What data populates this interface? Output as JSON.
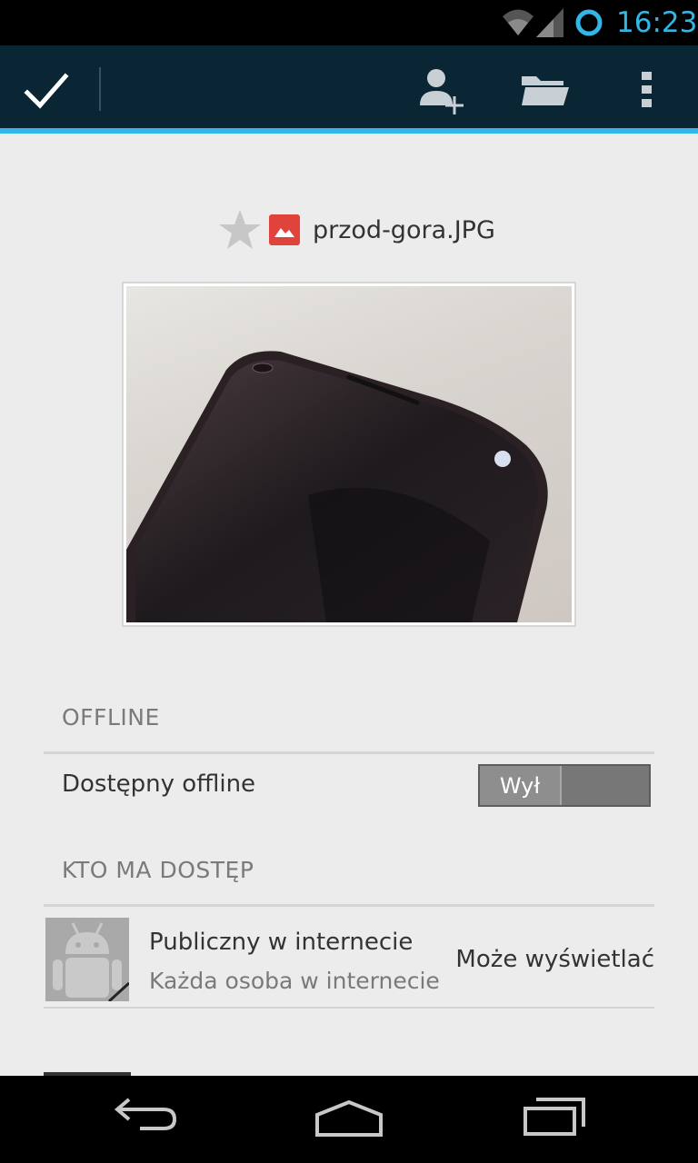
{
  "status_bar": {
    "time": "16:23",
    "icons": [
      "wifi-icon",
      "cell-signal-icon",
      "sync-icon"
    ],
    "accent": "#33b5e5"
  },
  "action_bar": {
    "icons": [
      "check-icon",
      "add-person-icon",
      "folder-icon",
      "overflow-menu-icon"
    ],
    "background": "#0a2533"
  },
  "file": {
    "name": "przod-gora.JPG",
    "starred": false,
    "type_icon": "image-icon",
    "type_color": "#e0433c"
  },
  "offline_section": {
    "header": "OFFLINE",
    "label": "Dostępny offline",
    "toggle_label": "Wył"
  },
  "access_section": {
    "header": "KTO MA DOSTĘP",
    "entries": [
      {
        "name": "Publiczny w internecie",
        "subtitle": "Każda osoba w internecie",
        "role": "Może wyświetlać",
        "avatar": "android-avatar-icon"
      }
    ]
  },
  "nav_bar": {
    "icons": [
      "back-icon",
      "home-icon",
      "recents-icon"
    ]
  }
}
